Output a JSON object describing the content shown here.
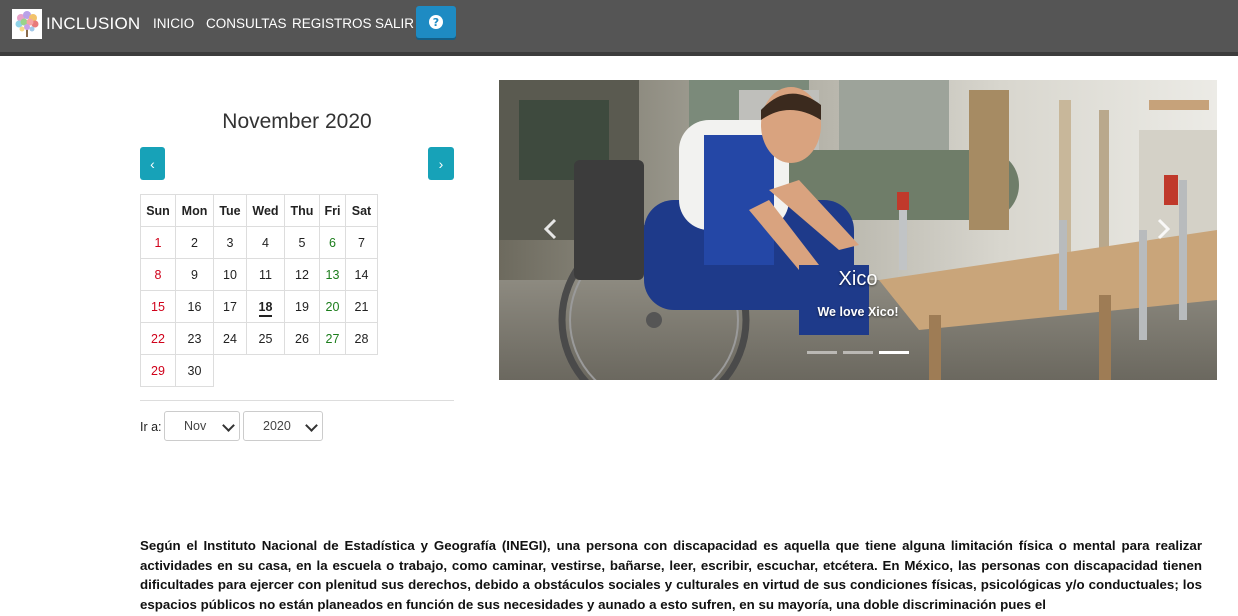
{
  "navbar": {
    "brand": "INCLUSION",
    "items": [
      {
        "label": "INICIO"
      },
      {
        "label": "CONSULTAS"
      },
      {
        "label": "REGISTROS"
      },
      {
        "label": "SALIR"
      }
    ],
    "help_icon": "question-circle-icon"
  },
  "calendar": {
    "title": "November 2020",
    "prev": "‹",
    "next": "›",
    "weekdays": [
      "Sun",
      "Mon",
      "Tue",
      "Wed",
      "Thu",
      "Fri",
      "Sat"
    ],
    "weeks": [
      [
        "1",
        "2",
        "3",
        "4",
        "5",
        "6",
        "7"
      ],
      [
        "8",
        "9",
        "10",
        "11",
        "12",
        "13",
        "14"
      ],
      [
        "15",
        "16",
        "17",
        "18",
        "19",
        "20",
        "21"
      ],
      [
        "22",
        "23",
        "24",
        "25",
        "26",
        "27",
        "28"
      ],
      [
        "29",
        "30",
        "",
        "",
        "",
        "",
        ""
      ]
    ],
    "today": "18",
    "goto_label": "Ir a:",
    "month_select": "Nov",
    "year_select": "2020",
    "colors": {
      "sunday": "#d0021b",
      "friday": "#1c7d1c",
      "nav_button": "#17a2b8"
    }
  },
  "carousel": {
    "caption_title": "Xico",
    "caption_text": "We love Xico!",
    "slide_count": 3,
    "active_slide": 3
  },
  "intro": {
    "text": "Según el Instituto Nacional de Estadística y Geografía (INEGI), una persona con discapacidad es aquella que tiene alguna limitación física o mental para realizar actividades en su casa, en la escuela o trabajo, como caminar, vestirse, bañarse, leer, escribir, escuchar, etcétera. En México, las personas con discapacidad tienen dificultades para ejercer con plenitud sus derechos, debido a obstáculos sociales y culturales en virtud de sus condiciones físicas, psicológicas y/o conductuales; los espacios públicos no están planeados en función de sus necesidades y aunado a esto sufren, en su mayoría, una doble discriminación pues el"
  }
}
